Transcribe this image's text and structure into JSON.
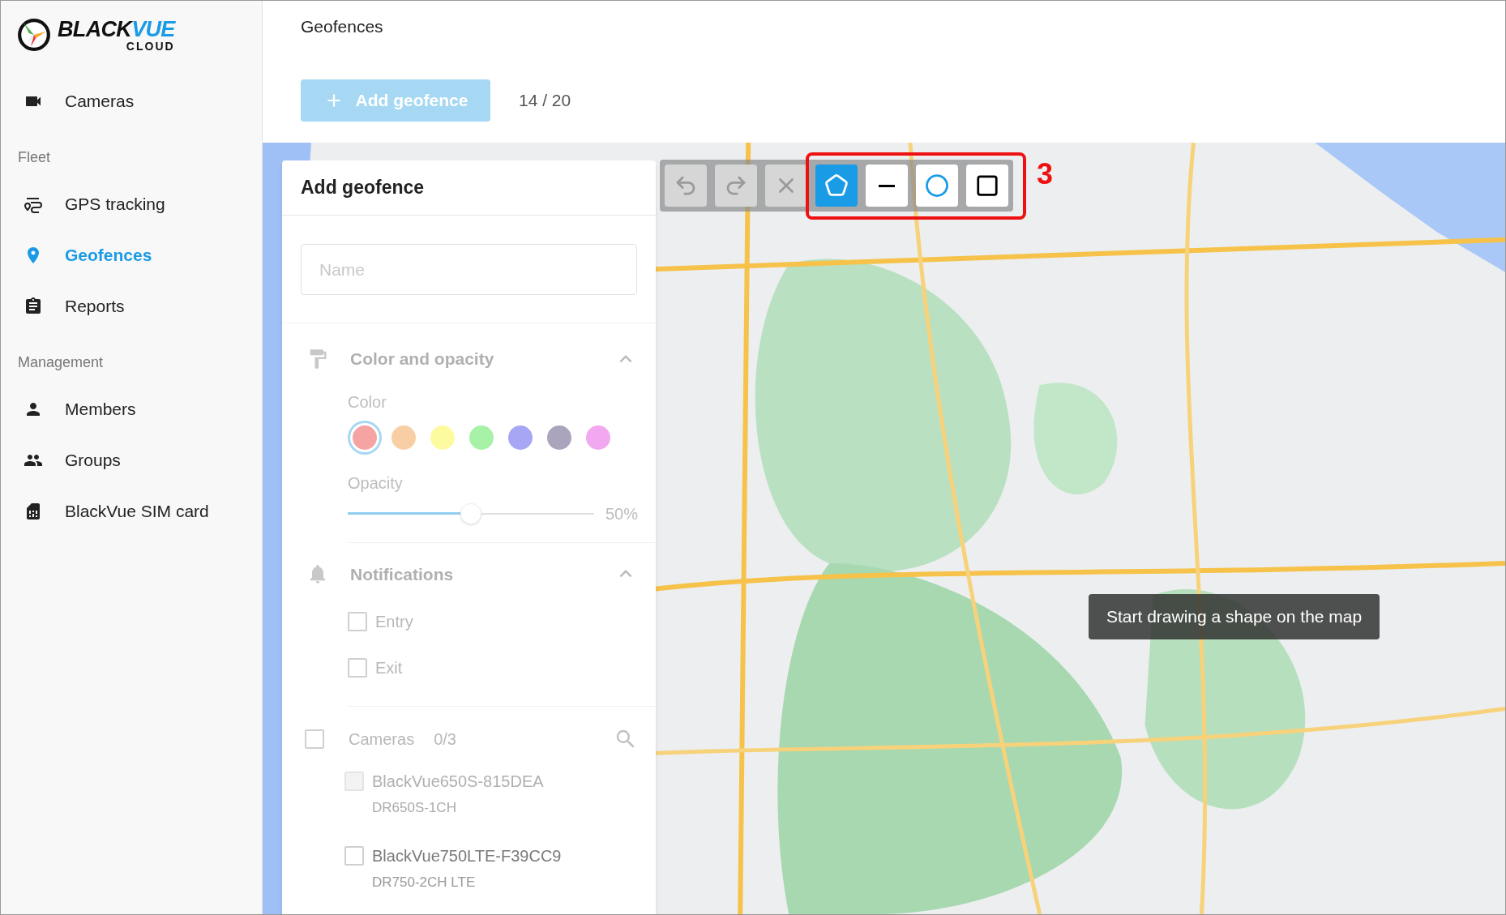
{
  "logo": {
    "brand_dark": "BLACK",
    "brand_accent": "VUE",
    "subtitle": "CLOUD"
  },
  "sidebar": {
    "groups": [
      {
        "items": [
          {
            "label": "Cameras",
            "selected": false
          }
        ]
      },
      {
        "heading": "Fleet",
        "items": [
          {
            "label": "GPS tracking",
            "selected": false
          },
          {
            "label": "Geofences",
            "selected": true
          },
          {
            "label": "Reports",
            "selected": false
          }
        ]
      },
      {
        "heading": "Management",
        "items": [
          {
            "label": "Members",
            "selected": false
          },
          {
            "label": "Groups",
            "selected": false
          },
          {
            "label": "BlackVue SIM card",
            "selected": false
          }
        ]
      }
    ]
  },
  "page_title": "Geofences",
  "add_button": {
    "label": "Add geofence",
    "disabled": true
  },
  "geofence_count": "14 / 20",
  "map": {
    "toolbar": [
      {
        "kind": "undo",
        "disabled": true,
        "selected": false
      },
      {
        "kind": "redo",
        "disabled": true,
        "selected": false
      },
      {
        "kind": "delete",
        "disabled": true,
        "selected": false
      },
      {
        "kind": "polygon",
        "disabled": false,
        "selected": true
      },
      {
        "kind": "line",
        "disabled": false,
        "selected": false
      },
      {
        "kind": "circle",
        "disabled": false,
        "selected": false
      },
      {
        "kind": "rectangle",
        "disabled": false,
        "selected": false
      }
    ],
    "annotation": {
      "label": "3"
    },
    "hint": "Start drawing a shape on the map"
  },
  "panel": {
    "title": "Add geofence",
    "name_field": {
      "placeholder": "Name"
    },
    "color_section": {
      "title": "Color and opacity",
      "expanded": true,
      "color_label": "Color",
      "swatches": [
        {
          "color": "#f6a3a3",
          "selected": true
        },
        {
          "color": "#f8cfa4",
          "selected": false
        },
        {
          "color": "#fdfba0",
          "selected": false
        },
        {
          "color": "#a8f2a8",
          "selected": false
        },
        {
          "color": "#a6a6f4",
          "selected": false
        },
        {
          "color": "#aaa4bc",
          "selected": false
        },
        {
          "color": "#f2a8f0",
          "selected": false
        }
      ],
      "opacity_label": "Opacity",
      "opacity": {
        "level": 0.5,
        "reading": "50%"
      }
    },
    "notifications": {
      "title": "Notifications",
      "expanded": true,
      "options": [
        {
          "label": "Entry",
          "checked": false
        },
        {
          "label": "Exit",
          "checked": false
        }
      ]
    },
    "cameras": {
      "label": "Cameras",
      "count": "0/3",
      "checked": false,
      "items": [
        {
          "name": "BlackVue650S-815DEA",
          "model": "DR650S-1CH",
          "checked": false,
          "disabled": true
        },
        {
          "name": "BlackVue750LTE-F39CC9",
          "model": "DR750-2CH LTE",
          "checked": false,
          "disabled": false
        }
      ]
    }
  }
}
